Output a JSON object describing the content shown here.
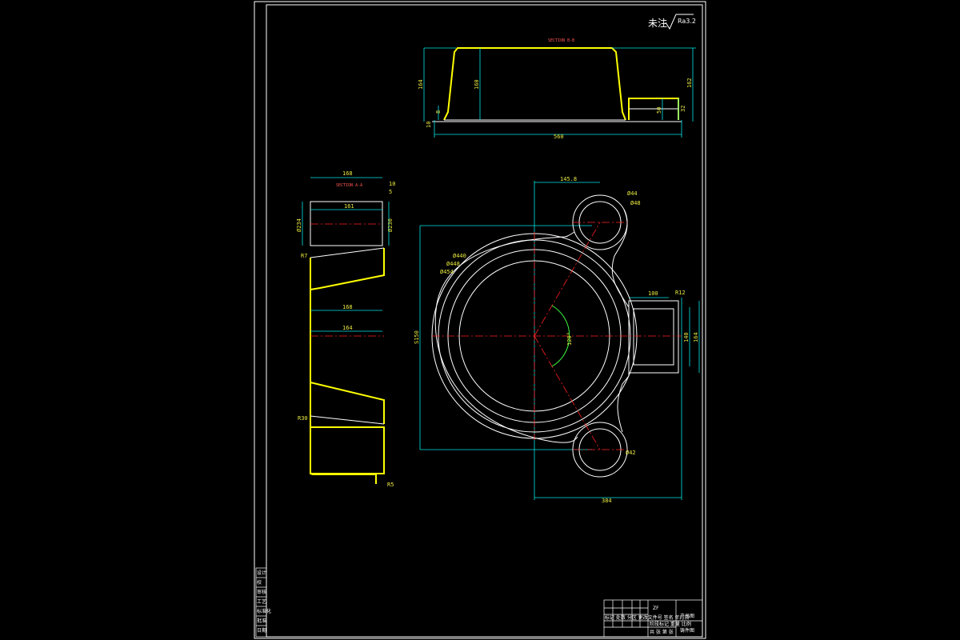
{
  "surface_note": {
    "prefix": "未注",
    "roughness": "Ra3.2"
  },
  "section_bb": {
    "title": "SECTION B-B",
    "dims": {
      "overall_width": "560",
      "height_left": "164",
      "height_inner": "160",
      "small_a": "10",
      "small_b": "8",
      "boss_height": "50",
      "right_total": "162",
      "right_small": "32"
    }
  },
  "section_aa": {
    "title": "SECTION A-A",
    "dims": {
      "top_width": "168",
      "top_inner": "161",
      "right_small": "10",
      "right_small2": "5",
      "left_dia": "Ø234",
      "right_dia": "Ø230",
      "r_top": "R7",
      "mid1": "168",
      "mid2": "164",
      "r_bottom": "R30",
      "r_end": "R5"
    }
  },
  "plan_view": {
    "dims": {
      "top_offset": "145.8",
      "boss_dia1": "Ø44",
      "boss_dia2": "Ø48",
      "ring_dia1": "Ø440",
      "ring_dia2": "Ø448",
      "ring_dia3": "Ø454",
      "height_overall": "S150",
      "angle": "120°",
      "flange_width": "100",
      "flange_r": "R12",
      "flange_inner": "140",
      "flange_outer": "164",
      "bottom_boss": "Ø42",
      "bottom_width": "384"
    }
  },
  "side_labels": [
    "设计",
    "校",
    "审核",
    "工艺",
    "标准化",
    "批准",
    "日期"
  ],
  "title_block": {
    "mark": "ZF",
    "name": "产品图",
    "drawing_no": "铸件图",
    "row_header": "标记 处数 分区 更改文件号 签名 年月日",
    "scale_row": "阶段标记 重量 比例",
    "footer": "共 张 第 张"
  }
}
